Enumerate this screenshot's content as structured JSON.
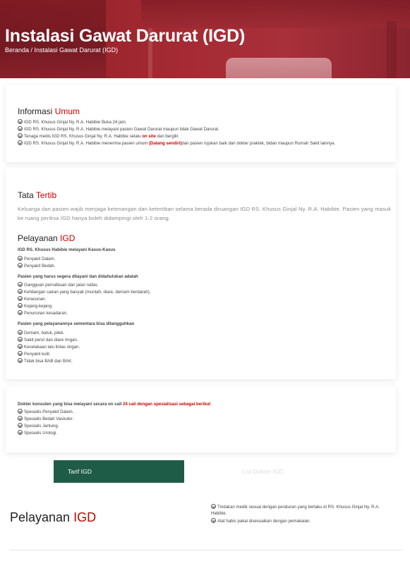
{
  "header": {
    "title": "Instalasi Gawat Darurat (IGD)",
    "breadcrumb": "Beranda / Instalasi Gawat Darurat (IGD)"
  },
  "informasi_umum": {
    "title_a": "Informasi ",
    "title_b": "Umum",
    "items": [
      {
        "text": "IGD RS. Khusus Ginjal Ny. R.A. Habibie Buka 24 jam."
      },
      {
        "text": "IGD RS. Khusus Ginjal Ny. R.A. Habibie melayani pasien Gawat Darurat maupun tidak Gawat Darurat."
      },
      {
        "pre": "Tenaga medis IGD RS. Khusus Ginjal Ny. R.A. Habibie selalu ",
        "hl": "on site",
        "post": " dan bergilir."
      },
      {
        "pre": "IGD RS. Khusus Ginjal Ny. R.A. Habibie menerima pasien umum ",
        "hl": "(Datang sendiri)",
        "post": "dan pasien rujukan baik dari dokter praktek, bidan maupun Rumah Sakit lainnya."
      }
    ]
  },
  "tata_tertib": {
    "title_a": "Tata ",
    "title_b": "Tertib",
    "text": "Keluarga dan pasien wajib menjaga ketenangan dan ketertiban selama berada diruangan IGD RS. Khusus Ginjal Ny. R.A. Habibie. Pasien yang masuk ke ruang periksa IGD hanya boleh didampingi oleh 1-2 orang."
  },
  "pelayanan": {
    "title_a": "Pelayanan ",
    "title_b": "IGD",
    "group1_title": "IGD RS. Khusus Habibie melayani Kasus-Kasus",
    "group1": [
      "Penyakit Dalam.",
      "Penyakit Bedah."
    ],
    "group2_title": "Pasien yang harus segera dilayani dan didahulukan adalah",
    "group2": [
      "Gangguan pernafasan dan jalan nafas.",
      "Kehilangan cairan yang banyak (muntah, diare, demam berdarah).",
      "Keracunan.",
      "Kejang-kejang.",
      "Penurunan kesadaran."
    ],
    "group3_title": "Pasien yang pelayanannya sementara bisa ditangguhkan",
    "group3": [
      "Demam, batuk, pilek.",
      "Sakit perut dan diare ringan.",
      "Kecelakaan lalu lintas ringan.",
      "Penyakit kulit.",
      "Tidak bisa BAB dan BAK."
    ]
  },
  "konsulen": {
    "title_pre": "Dokter konsulen yang bisa melayani secara on call ",
    "title_hl": "24 cali dengan spesialisasi sebagai berikut",
    "items": [
      "Spesialis Penyakit Dalam.",
      "Spesialis Bedah Vaskuler.",
      "Spesialis Jantung.",
      "Spesialis Urologi."
    ]
  },
  "tabs": {
    "active": "Tarif IGD",
    "inactive": "List Dokter IGD"
  },
  "bottom": {
    "title_a": "Pelayanan ",
    "title_b": "IGD",
    "items": [
      "Tindakan medik sesuai dengan peraturan yang berlaku di RS. Khusus Ginjal Ny. R.A. Habibie.",
      "Alat habis pakai disesuaikan dengan pemakaian."
    ]
  },
  "colors": {
    "accent_red": "#cc0000",
    "tab_green": "#1f5c48",
    "hero": "#a52a33"
  }
}
